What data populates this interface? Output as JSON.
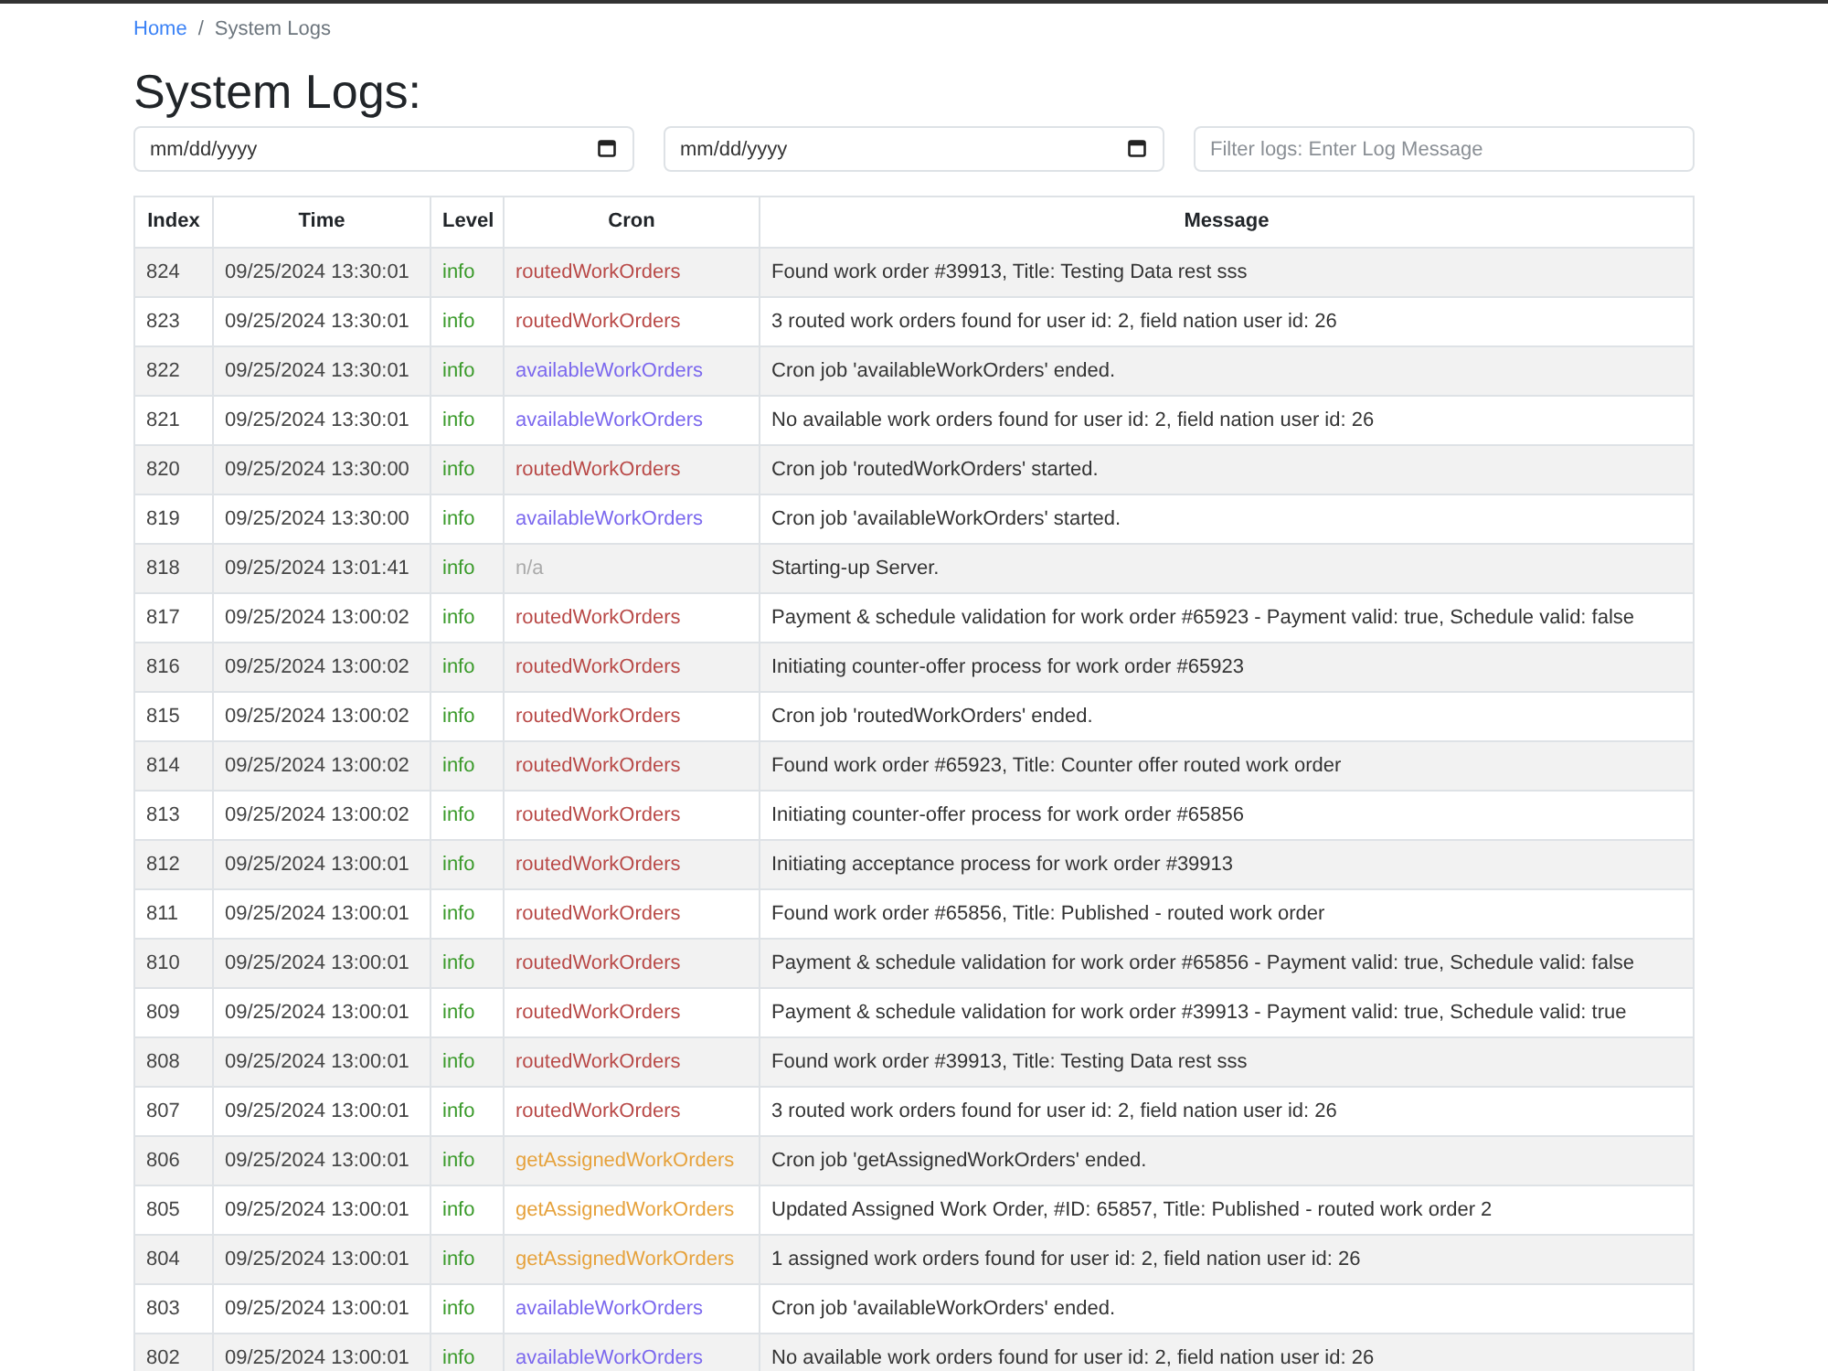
{
  "breadcrumb": {
    "separator": "/",
    "items": [
      {
        "label": "Home",
        "kind": "link"
      },
      {
        "label": "System Logs",
        "kind": "current"
      }
    ]
  },
  "title": "System Logs:",
  "filters": [
    {
      "kind": "date",
      "placeholder": "mm/dd/yyyy"
    },
    {
      "kind": "date",
      "placeholder": "mm/dd/yyyy"
    },
    {
      "kind": "text",
      "placeholder": "Filter logs: Enter Log Message"
    }
  ],
  "table": {
    "columns": [
      "Index",
      "Time",
      "Level",
      "Cron",
      "Message"
    ],
    "rows": [
      {
        "index": "824",
        "time": "09/25/2024 13:30:01",
        "level": "info",
        "cron": "routedWorkOrders",
        "color": "#b94a48",
        "message": "Found work order #39913, Title: Testing Data rest sss"
      },
      {
        "index": "823",
        "time": "09/25/2024 13:30:01",
        "level": "info",
        "cron": "routedWorkOrders",
        "color": "#b94a48",
        "message": "3 routed work orders found for user id: 2, field nation user id: 26"
      },
      {
        "index": "822",
        "time": "09/25/2024 13:30:01",
        "level": "info",
        "cron": "availableWorkOrders",
        "color": "#7b68ee",
        "message": "Cron job 'availableWorkOrders' ended."
      },
      {
        "index": "821",
        "time": "09/25/2024 13:30:01",
        "level": "info",
        "cron": "availableWorkOrders",
        "color": "#7b68ee",
        "message": "No available work orders found for user id: 2, field nation user id: 26"
      },
      {
        "index": "820",
        "time": "09/25/2024 13:30:00",
        "level": "info",
        "cron": "routedWorkOrders",
        "color": "#b94a48",
        "message": "Cron job 'routedWorkOrders' started."
      },
      {
        "index": "819",
        "time": "09/25/2024 13:30:00",
        "level": "info",
        "cron": "availableWorkOrders",
        "color": "#7b68ee",
        "message": "Cron job 'availableWorkOrders' started."
      },
      {
        "index": "818",
        "time": "09/25/2024 13:01:41",
        "level": "info",
        "cron": "n/a",
        "color": "#aaaaaa",
        "message": "Starting-up Server."
      },
      {
        "index": "817",
        "time": "09/25/2024 13:00:02",
        "level": "info",
        "cron": "routedWorkOrders",
        "color": "#b94a48",
        "message": "Payment & schedule validation for work order #65923 - Payment valid: true, Schedule valid: false"
      },
      {
        "index": "816",
        "time": "09/25/2024 13:00:02",
        "level": "info",
        "cron": "routedWorkOrders",
        "color": "#b94a48",
        "message": "Initiating counter-offer process for work order #65923"
      },
      {
        "index": "815",
        "time": "09/25/2024 13:00:02",
        "level": "info",
        "cron": "routedWorkOrders",
        "color": "#b94a48",
        "message": "Cron job 'routedWorkOrders' ended."
      },
      {
        "index": "814",
        "time": "09/25/2024 13:00:02",
        "level": "info",
        "cron": "routedWorkOrders",
        "color": "#b94a48",
        "message": "Found work order #65923, Title: Counter offer routed work order"
      },
      {
        "index": "813",
        "time": "09/25/2024 13:00:02",
        "level": "info",
        "cron": "routedWorkOrders",
        "color": "#b94a48",
        "message": "Initiating counter-offer process for work order #65856"
      },
      {
        "index": "812",
        "time": "09/25/2024 13:00:01",
        "level": "info",
        "cron": "routedWorkOrders",
        "color": "#b94a48",
        "message": "Initiating acceptance process for work order #39913"
      },
      {
        "index": "811",
        "time": "09/25/2024 13:00:01",
        "level": "info",
        "cron": "routedWorkOrders",
        "color": "#b94a48",
        "message": "Found work order #65856, Title: Published - routed work order"
      },
      {
        "index": "810",
        "time": "09/25/2024 13:00:01",
        "level": "info",
        "cron": "routedWorkOrders",
        "color": "#b94a48",
        "message": "Payment & schedule validation for work order #65856 - Payment valid: true, Schedule valid: false"
      },
      {
        "index": "809",
        "time": "09/25/2024 13:00:01",
        "level": "info",
        "cron": "routedWorkOrders",
        "color": "#b94a48",
        "message": "Payment & schedule validation for work order #39913 - Payment valid: true, Schedule valid: true"
      },
      {
        "index": "808",
        "time": "09/25/2024 13:00:01",
        "level": "info",
        "cron": "routedWorkOrders",
        "color": "#b94a48",
        "message": "Found work order #39913, Title: Testing Data rest sss"
      },
      {
        "index": "807",
        "time": "09/25/2024 13:00:01",
        "level": "info",
        "cron": "routedWorkOrders",
        "color": "#b94a48",
        "message": "3 routed work orders found for user id: 2, field nation user id: 26"
      },
      {
        "index": "806",
        "time": "09/25/2024 13:00:01",
        "level": "info",
        "cron": "getAssignedWorkOrders",
        "color": "#e6a23c",
        "message": "Cron job 'getAssignedWorkOrders' ended."
      },
      {
        "index": "805",
        "time": "09/25/2024 13:00:01",
        "level": "info",
        "cron": "getAssignedWorkOrders",
        "color": "#e6a23c",
        "message": "Updated Assigned Work Order, #ID: 65857, Title: Published - routed work order 2"
      },
      {
        "index": "804",
        "time": "09/25/2024 13:00:01",
        "level": "info",
        "cron": "getAssignedWorkOrders",
        "color": "#e6a23c",
        "message": "1 assigned work orders found for user id: 2, field nation user id: 26"
      },
      {
        "index": "803",
        "time": "09/25/2024 13:00:01",
        "level": "info",
        "cron": "availableWorkOrders",
        "color": "#7b68ee",
        "message": "Cron job 'availableWorkOrders' ended."
      },
      {
        "index": "802",
        "time": "09/25/2024 13:00:01",
        "level": "info",
        "cron": "availableWorkOrders",
        "color": "#7b68ee",
        "message": "No available work orders found for user id: 2, field nation user id: 26"
      }
    ]
  }
}
